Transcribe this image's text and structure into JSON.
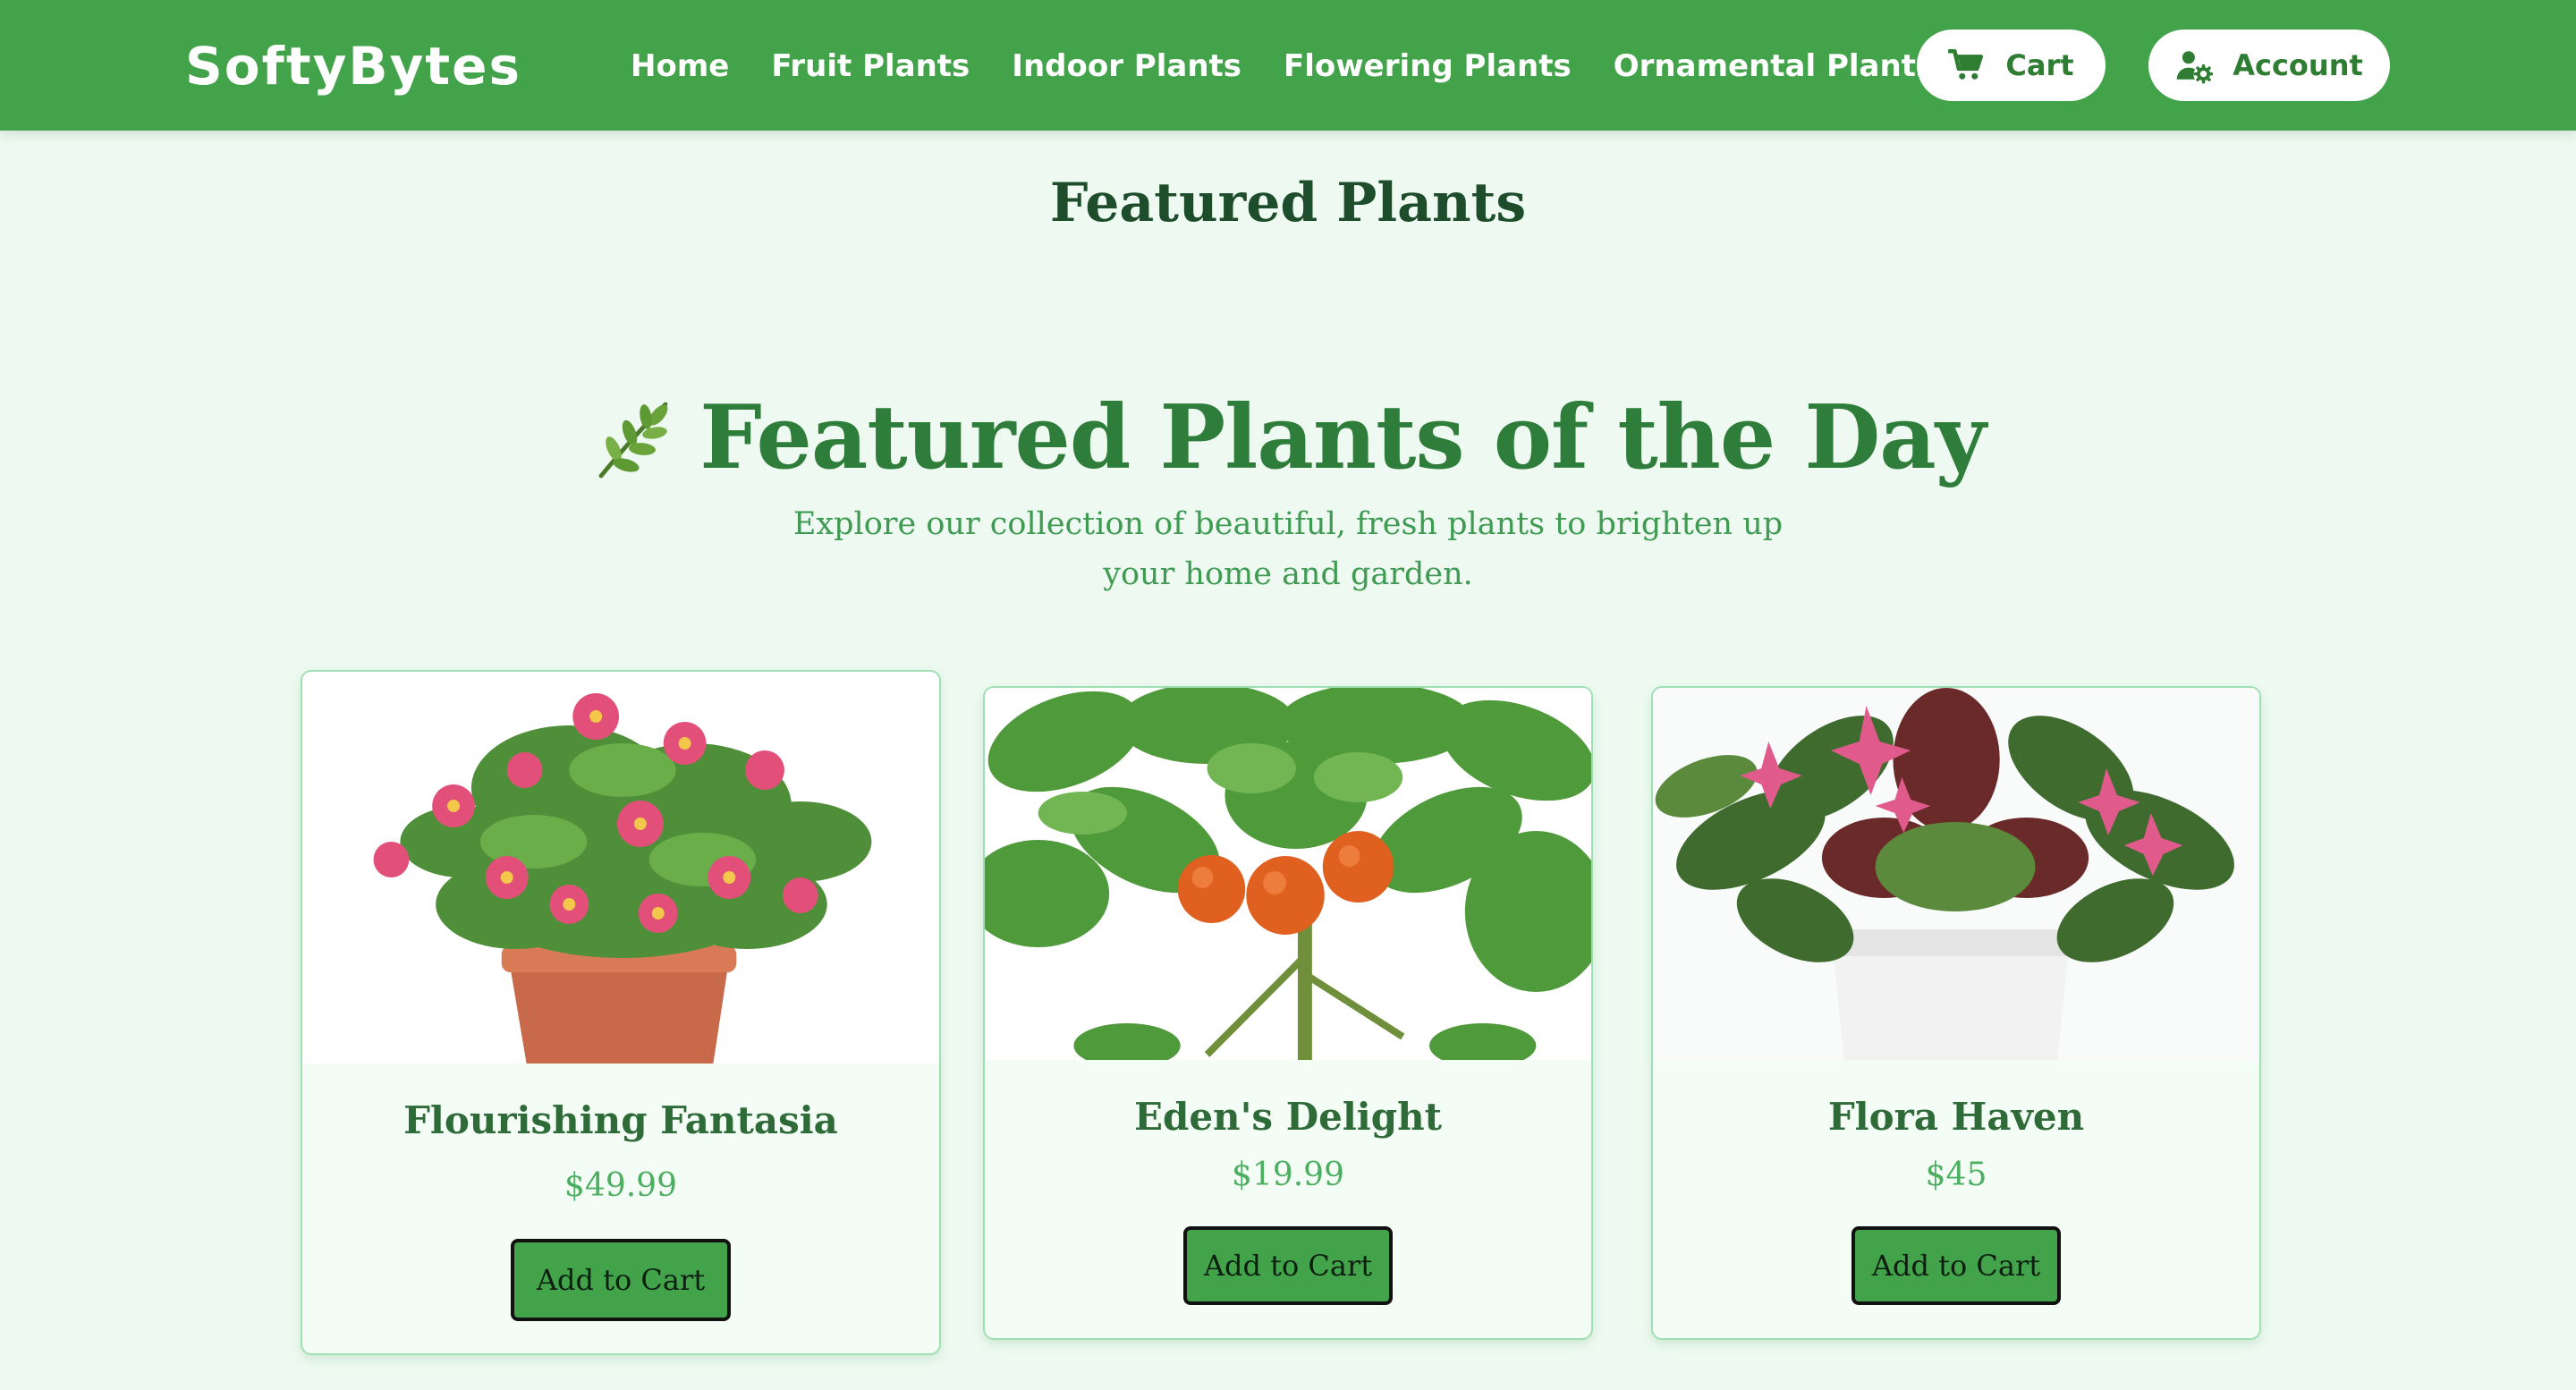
{
  "navbar": {
    "brand": "SoftyBytes",
    "links": [
      "Home",
      "Fruit Plants",
      "Indoor Plants",
      "Flowering Plants",
      "Ornamental Plants"
    ],
    "cart_label": "Cart",
    "account_label": "Account",
    "cart_icon": "shopping-cart-icon",
    "account_icon": "user-gear-icon"
  },
  "page": {
    "title": "Featured Plants",
    "hero_icon": "herb-leaf-icon",
    "hero_title": "Featured Plants of the Day",
    "hero_subtitle": "Explore our collection of beautiful, fresh plants to brighten up your home and garden."
  },
  "products": [
    {
      "name": "Flourishing Fantasia",
      "price": "$49.99",
      "button": "Add to Cart",
      "image": "pink-flowering-plant-terracotta-pot"
    },
    {
      "name": "Eden's Delight",
      "price": "$19.99",
      "button": "Add to Cart",
      "image": "cherry-tomato-plant"
    },
    {
      "name": "Flora Haven",
      "price": "$45",
      "button": "Add to Cart",
      "image": "pink-flowered-plant-white-pot"
    }
  ],
  "colors": {
    "nav_green": "#43a34a",
    "page_bg": "#eefaf1",
    "heading_dark": "#1e4d2b",
    "hero_green": "#2f7d3a",
    "price_green": "#4caf60"
  }
}
